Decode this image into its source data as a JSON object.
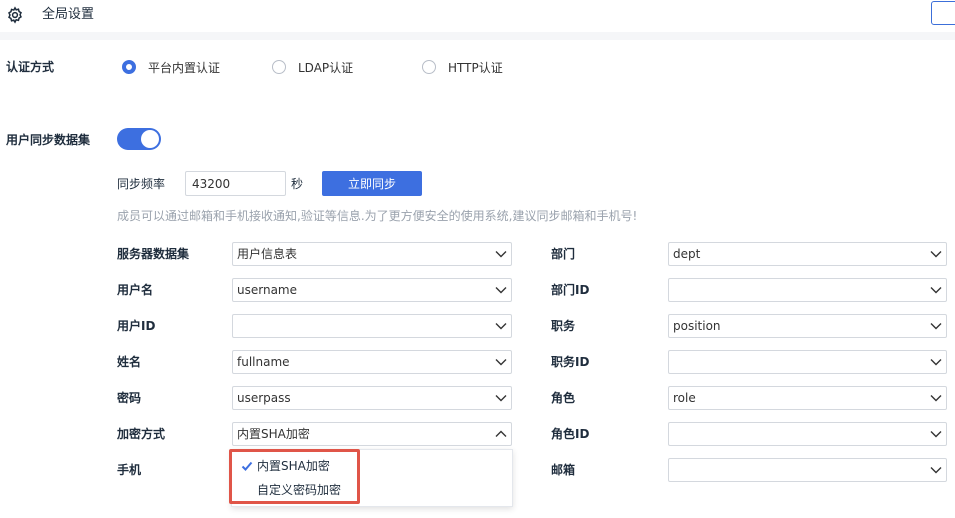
{
  "header": {
    "title": "全局设置"
  },
  "auth": {
    "label": "认证方式",
    "options": [
      "平台内置认证",
      "LDAP认证",
      "HTTP认证"
    ],
    "selected_index": 0
  },
  "sync": {
    "label": "用户同步数据集",
    "enabled": true,
    "freq_label": "同步频率",
    "freq_value": "43200",
    "freq_unit": "秒",
    "sync_button": "立即同步",
    "hint": "成员可以通过邮箱和手机接收通知,验证等信息.为了更方便安全的使用系统,建议同步邮箱和手机号!"
  },
  "fields_left": [
    {
      "label": "服务器数据集",
      "value": "用户信息表"
    },
    {
      "label": "用户名",
      "value": "username"
    },
    {
      "label": "用户ID",
      "value": ""
    },
    {
      "label": "姓名",
      "value": "fullname"
    },
    {
      "label": "密码",
      "value": "userpass"
    },
    {
      "label": "加密方式",
      "value": "内置SHA加密",
      "open": true
    },
    {
      "label": "手机",
      "value": ""
    }
  ],
  "fields_right": [
    {
      "label": "部门",
      "value": "dept"
    },
    {
      "label": "部门ID",
      "value": ""
    },
    {
      "label": "职务",
      "value": "position"
    },
    {
      "label": "职务ID",
      "value": ""
    },
    {
      "label": "角色",
      "value": "role"
    },
    {
      "label": "角色ID",
      "value": ""
    },
    {
      "label": "邮箱",
      "value": ""
    }
  ],
  "encryption_dropdown": {
    "options": [
      "内置SHA加密",
      "自定义密码加密"
    ],
    "selected_index": 0
  },
  "colors": {
    "accent": "#3d6fe0",
    "highlight": "#e05548"
  }
}
